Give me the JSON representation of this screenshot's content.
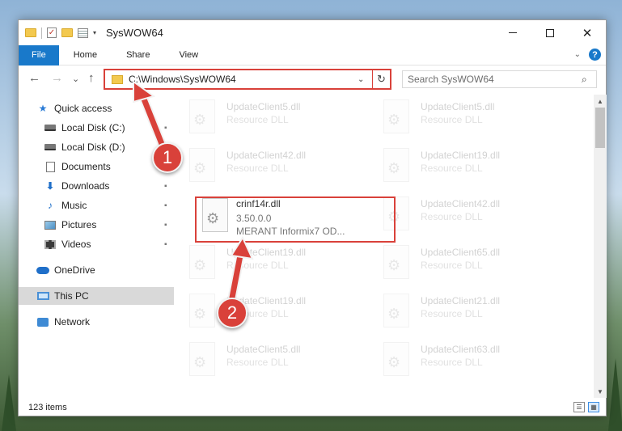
{
  "window": {
    "title": "SysWOW64",
    "qa_dropdown": "▾",
    "min_label": "",
    "max_label": "",
    "close_label": "✕"
  },
  "ribbon": {
    "tabs": [
      "File",
      "Home",
      "Share",
      "View"
    ],
    "help_label": "?",
    "collapse_label": "⌄"
  },
  "nav": {
    "back": "←",
    "forward": "→",
    "recent": "⌄",
    "up": "↑",
    "path": "C:\\Windows\\SysWOW64",
    "address_dropdown": "⌄",
    "refresh": "↻",
    "search_placeholder": "Search SysWOW64",
    "search_icon": "⌕"
  },
  "sidebar": {
    "items": [
      {
        "label": "Quick access",
        "icon": "star-icon"
      },
      {
        "label": "Local Disk (C:)",
        "icon": "drive-icon",
        "pinned": true
      },
      {
        "label": "Local Disk (D:)",
        "icon": "drive-icon",
        "pinned": false
      },
      {
        "label": "Documents",
        "icon": "document-icon",
        "pinned": true
      },
      {
        "label": "Downloads",
        "icon": "download-icon",
        "pinned": true
      },
      {
        "label": "Music",
        "icon": "music-icon",
        "pinned": true
      },
      {
        "label": "Pictures",
        "icon": "picture-icon",
        "pinned": true
      },
      {
        "label": "Videos",
        "icon": "video-icon",
        "pinned": true
      },
      {
        "label": "OneDrive",
        "icon": "cloud-icon"
      },
      {
        "label": "This PC",
        "icon": "computer-icon",
        "selected": true
      },
      {
        "label": "Network",
        "icon": "network-icon"
      }
    ],
    "pin_glyph": "📌",
    "star_glyph": "★",
    "download_glyph": "⬇",
    "music_glyph": "♪"
  },
  "files": {
    "left_column": [
      {
        "name": "UpdateClient5.dll",
        "desc": "Resource DLL"
      },
      {
        "name": "UpdateClient42.dll",
        "desc": "Resource DLL"
      },
      {
        "name": "crinf14r.dll",
        "version": "3.50.0.0",
        "desc": "MERANT Informix7 OD...",
        "highlighted": true
      },
      {
        "name": "UpdateClient19.dll",
        "desc": "Resource DLL"
      },
      {
        "name": "UpdateClient19.dll",
        "desc": "Resource DLL"
      },
      {
        "name": "UpdateClient5.dll",
        "desc": "Resource DLL"
      }
    ],
    "right_column": [
      {
        "name": "UpdateClient5.dll",
        "desc": "Resource DLL"
      },
      {
        "name": "UpdateClient19.dll",
        "desc": "Resource DLL"
      },
      {
        "name": "UpdateClient42.dll",
        "desc": "Resource DLL"
      },
      {
        "name": "UpdateClient65.dll",
        "desc": "Resource DLL"
      },
      {
        "name": "UpdateClient21.dll",
        "desc": "Resource DLL"
      },
      {
        "name": "UpdateClient63.dll",
        "desc": "Resource DLL"
      }
    ]
  },
  "scrollbar": {
    "up": "▲",
    "down": "▼"
  },
  "status": {
    "item_count": "123 items",
    "details_view": "☰",
    "tiles_view": "▦"
  },
  "annotations": {
    "step1": "1",
    "step2": "2"
  },
  "colors": {
    "accent": "#1979ca",
    "annotation_red": "#d9413a"
  }
}
